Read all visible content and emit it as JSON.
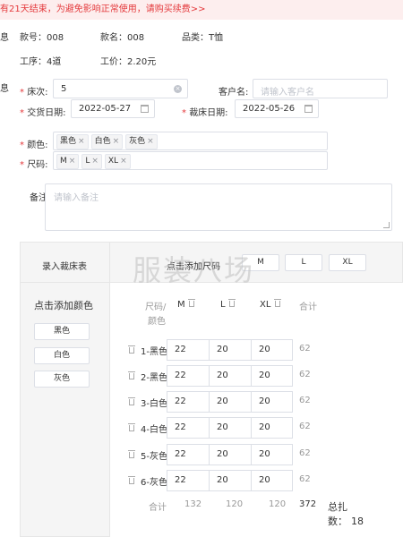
{
  "banner": "有21天结束，为避免影响正常使用，请购买续费>>",
  "info": {
    "section_mark_1": "息",
    "section_mark_2": "息",
    "style_no": "款号：008",
    "style_name": "款名：008",
    "category": "品类：T恤",
    "process": "工序：4道",
    "price": "工价：2.20元"
  },
  "form": {
    "bed_label": "床次:",
    "bed_value": "5",
    "customer_label": "客户名:",
    "customer_placeholder": "请输入客户名",
    "delivery_label": "交货日期:",
    "delivery_value": "2022-05-27",
    "cut_label": "裁床日期:",
    "cut_value": "2022-05-26",
    "color_label": "颜色:",
    "colors": [
      "黑色",
      "白色",
      "灰色"
    ],
    "size_label": "尺码:",
    "sizes": [
      "M",
      "L",
      "XL"
    ],
    "remark_label": "备注:",
    "remark_placeholder": "请输入备注"
  },
  "table": {
    "record_title": "录入裁床表",
    "add_size": "点击添加尺码",
    "size_buttons": [
      "M",
      "L",
      "XL"
    ],
    "add_color": "点击添加颜色",
    "color_buttons": [
      "黑色",
      "白色",
      "灰色"
    ],
    "corner_top": "尺码/",
    "corner_bottom": "颜色",
    "col_headers": [
      "M",
      "L",
      "XL"
    ],
    "total_header": "合计",
    "rows": [
      {
        "label": "1-黑色",
        "m": "22",
        "l": "20",
        "xl": "20",
        "total": "62"
      },
      {
        "label": "2-黑色",
        "m": "22",
        "l": "20",
        "xl": "20",
        "total": "62"
      },
      {
        "label": "3-白色",
        "m": "22",
        "l": "20",
        "xl": "20",
        "total": "62"
      },
      {
        "label": "4-白色",
        "m": "22",
        "l": "20",
        "xl": "20",
        "total": "62"
      },
      {
        "label": "5-灰色",
        "m": "22",
        "l": "20",
        "xl": "20",
        "total": "62"
      },
      {
        "label": "6-灰色",
        "m": "22",
        "l": "20",
        "xl": "20",
        "total": "62"
      }
    ],
    "sum_label": "合计",
    "sum_m": "132",
    "sum_l": "120",
    "sum_xl": "120",
    "sum_total": "372",
    "bundle_line1": "总扎",
    "bundle_line2": "数：",
    "bundle_count": "18"
  },
  "watermark": "服装八场"
}
